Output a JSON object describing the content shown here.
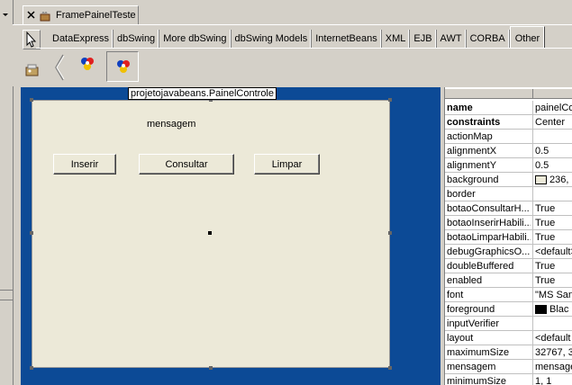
{
  "file_tab": {
    "label": "FramePainelTeste"
  },
  "palette": {
    "tabs": [
      "DataExpress",
      "dbSwing",
      "More dbSwing",
      "dbSwing Models",
      "InternetBeans",
      "XML",
      "EJB",
      "AWT",
      "CORBA",
      "Other"
    ],
    "active_tab": "Other"
  },
  "designer": {
    "component_label": "projetojavabeans.PainelControle",
    "mensagem_label": "mensagem",
    "buttons": {
      "inserir": "Inserir",
      "consultar": "Consultar",
      "limpar": "Limpar"
    }
  },
  "inspector": {
    "properties": [
      {
        "name": "name",
        "value": "painelCo",
        "bold": true
      },
      {
        "name": "constraints",
        "value": "Center",
        "bold": true
      },
      {
        "name": "actionMap",
        "value": ""
      },
      {
        "name": "alignmentX",
        "value": "0.5"
      },
      {
        "name": "alignmentY",
        "value": "0.5"
      },
      {
        "name": "background",
        "value": "236,",
        "swatch": "#ece9d8"
      },
      {
        "name": "border",
        "value": ""
      },
      {
        "name": "botaoConsultarH...",
        "value": "True"
      },
      {
        "name": "botaoInserirHabili...",
        "value": "True"
      },
      {
        "name": "botaoLimparHabili...",
        "value": "True"
      },
      {
        "name": "debugGraphicsO...",
        "value": "<default>"
      },
      {
        "name": "doubleBuffered",
        "value": "True"
      },
      {
        "name": "enabled",
        "value": "True"
      },
      {
        "name": "font",
        "value": "\"MS San"
      },
      {
        "name": "foreground",
        "value": "Blac",
        "swatch": "#000000"
      },
      {
        "name": "inputVerifier",
        "value": ""
      },
      {
        "name": "layout",
        "value": "<default"
      },
      {
        "name": "maximumSize",
        "value": "32767, 3"
      },
      {
        "name": "mensagem",
        "value": "mensage"
      },
      {
        "name": "minimumSize",
        "value": "1, 1"
      }
    ]
  },
  "colors": {
    "design_bg": "#0c4a96",
    "panel_bg": "#ece9d8",
    "chrome": "#d4d0c8"
  }
}
